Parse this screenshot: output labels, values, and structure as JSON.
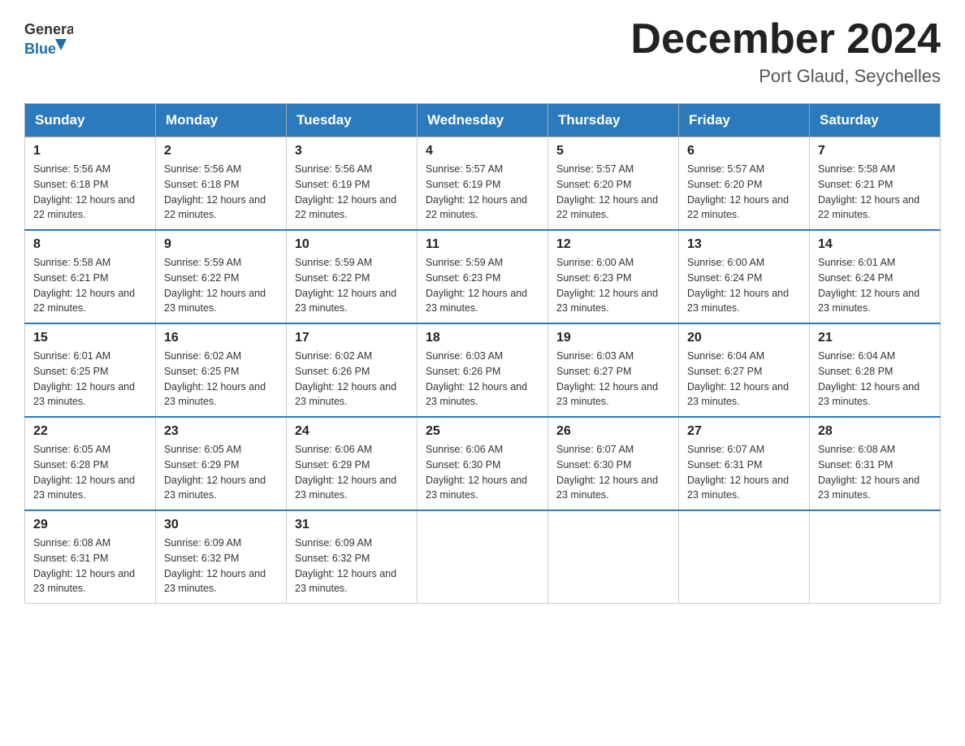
{
  "header": {
    "logo_general": "General",
    "logo_blue": "Blue",
    "month_title": "December 2024",
    "location": "Port Glaud, Seychelles"
  },
  "weekdays": [
    "Sunday",
    "Monday",
    "Tuesday",
    "Wednesday",
    "Thursday",
    "Friday",
    "Saturday"
  ],
  "weeks": [
    [
      {
        "day": "1",
        "sunrise": "5:56 AM",
        "sunset": "6:18 PM",
        "daylight": "12 hours and 22 minutes."
      },
      {
        "day": "2",
        "sunrise": "5:56 AM",
        "sunset": "6:18 PM",
        "daylight": "12 hours and 22 minutes."
      },
      {
        "day": "3",
        "sunrise": "5:56 AM",
        "sunset": "6:19 PM",
        "daylight": "12 hours and 22 minutes."
      },
      {
        "day": "4",
        "sunrise": "5:57 AM",
        "sunset": "6:19 PM",
        "daylight": "12 hours and 22 minutes."
      },
      {
        "day": "5",
        "sunrise": "5:57 AM",
        "sunset": "6:20 PM",
        "daylight": "12 hours and 22 minutes."
      },
      {
        "day": "6",
        "sunrise": "5:57 AM",
        "sunset": "6:20 PM",
        "daylight": "12 hours and 22 minutes."
      },
      {
        "day": "7",
        "sunrise": "5:58 AM",
        "sunset": "6:21 PM",
        "daylight": "12 hours and 22 minutes."
      }
    ],
    [
      {
        "day": "8",
        "sunrise": "5:58 AM",
        "sunset": "6:21 PM",
        "daylight": "12 hours and 22 minutes."
      },
      {
        "day": "9",
        "sunrise": "5:59 AM",
        "sunset": "6:22 PM",
        "daylight": "12 hours and 23 minutes."
      },
      {
        "day": "10",
        "sunrise": "5:59 AM",
        "sunset": "6:22 PM",
        "daylight": "12 hours and 23 minutes."
      },
      {
        "day": "11",
        "sunrise": "5:59 AM",
        "sunset": "6:23 PM",
        "daylight": "12 hours and 23 minutes."
      },
      {
        "day": "12",
        "sunrise": "6:00 AM",
        "sunset": "6:23 PM",
        "daylight": "12 hours and 23 minutes."
      },
      {
        "day": "13",
        "sunrise": "6:00 AM",
        "sunset": "6:24 PM",
        "daylight": "12 hours and 23 minutes."
      },
      {
        "day": "14",
        "sunrise": "6:01 AM",
        "sunset": "6:24 PM",
        "daylight": "12 hours and 23 minutes."
      }
    ],
    [
      {
        "day": "15",
        "sunrise": "6:01 AM",
        "sunset": "6:25 PM",
        "daylight": "12 hours and 23 minutes."
      },
      {
        "day": "16",
        "sunrise": "6:02 AM",
        "sunset": "6:25 PM",
        "daylight": "12 hours and 23 minutes."
      },
      {
        "day": "17",
        "sunrise": "6:02 AM",
        "sunset": "6:26 PM",
        "daylight": "12 hours and 23 minutes."
      },
      {
        "day": "18",
        "sunrise": "6:03 AM",
        "sunset": "6:26 PM",
        "daylight": "12 hours and 23 minutes."
      },
      {
        "day": "19",
        "sunrise": "6:03 AM",
        "sunset": "6:27 PM",
        "daylight": "12 hours and 23 minutes."
      },
      {
        "day": "20",
        "sunrise": "6:04 AM",
        "sunset": "6:27 PM",
        "daylight": "12 hours and 23 minutes."
      },
      {
        "day": "21",
        "sunrise": "6:04 AM",
        "sunset": "6:28 PM",
        "daylight": "12 hours and 23 minutes."
      }
    ],
    [
      {
        "day": "22",
        "sunrise": "6:05 AM",
        "sunset": "6:28 PM",
        "daylight": "12 hours and 23 minutes."
      },
      {
        "day": "23",
        "sunrise": "6:05 AM",
        "sunset": "6:29 PM",
        "daylight": "12 hours and 23 minutes."
      },
      {
        "day": "24",
        "sunrise": "6:06 AM",
        "sunset": "6:29 PM",
        "daylight": "12 hours and 23 minutes."
      },
      {
        "day": "25",
        "sunrise": "6:06 AM",
        "sunset": "6:30 PM",
        "daylight": "12 hours and 23 minutes."
      },
      {
        "day": "26",
        "sunrise": "6:07 AM",
        "sunset": "6:30 PM",
        "daylight": "12 hours and 23 minutes."
      },
      {
        "day": "27",
        "sunrise": "6:07 AM",
        "sunset": "6:31 PM",
        "daylight": "12 hours and 23 minutes."
      },
      {
        "day": "28",
        "sunrise": "6:08 AM",
        "sunset": "6:31 PM",
        "daylight": "12 hours and 23 minutes."
      }
    ],
    [
      {
        "day": "29",
        "sunrise": "6:08 AM",
        "sunset": "6:31 PM",
        "daylight": "12 hours and 23 minutes."
      },
      {
        "day": "30",
        "sunrise": "6:09 AM",
        "sunset": "6:32 PM",
        "daylight": "12 hours and 23 minutes."
      },
      {
        "day": "31",
        "sunrise": "6:09 AM",
        "sunset": "6:32 PM",
        "daylight": "12 hours and 23 minutes."
      },
      null,
      null,
      null,
      null
    ]
  ]
}
